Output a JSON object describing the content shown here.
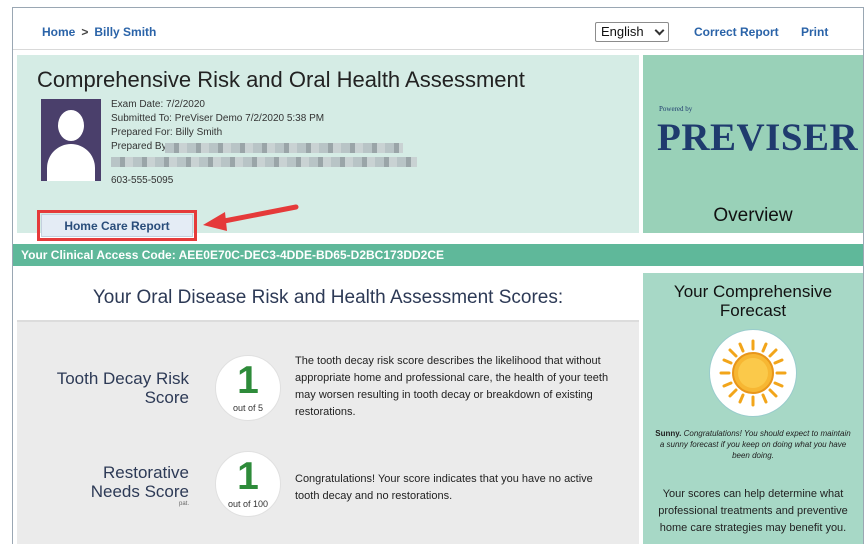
{
  "breadcrumb": {
    "home": "Home",
    "separator": ">",
    "current": "Billy Smith"
  },
  "language_select": {
    "value": "English"
  },
  "toplinks": {
    "correct_report": "Correct Report",
    "print": "Print"
  },
  "header": {
    "title": "Comprehensive Risk and Oral Health Assessment",
    "exam_date": "Exam Date: 7/2/2020",
    "submitted_to": "Submitted To: PreViser Demo 7/2/2020 5:38 PM",
    "prepared_for": "Prepared For: Billy Smith",
    "prepared_by": "Prepared By:",
    "phone": "603-555-5095",
    "home_care_button": "Home Care Report"
  },
  "brand": {
    "powered_by": "Powered by",
    "logo": "PREVISER",
    "panel_label": "Overview"
  },
  "access_code": {
    "text": "Your Clinical Access Code: AEE0E70C-DEC3-4DDE-BD65-D2BC173DD2CE"
  },
  "scores": {
    "title": "Your Oral Disease Risk and Health Assessment Scores:",
    "items": [
      {
        "name_line1": "Tooth Decay Risk",
        "name_line2": "Score",
        "value": "1",
        "out_of": "out of 5",
        "description": "The tooth decay risk score describes the likelihood that without appropriate home and professional care, the health of your teeth may worsen resulting in tooth decay or breakdown of existing restorations."
      },
      {
        "name_line1": "Restorative",
        "name_line2": "Needs Score",
        "suffix": "pat.",
        "value": "1",
        "out_of": "out of 100",
        "description": "Congratulations! Your score indicates that you have no active tooth decay and no restorations."
      }
    ]
  },
  "forecast": {
    "title_line1": "Your Comprehensive",
    "title_line2": "Forecast",
    "icon": "sun-icon",
    "sunny_label": "Sunny.",
    "sunny_text": "Congratulations! You should expect to maintain a sunny forecast if you keep on doing what you have been doing.",
    "summary": "Your scores can help determine what professional treatments and preventive home care strategies may benefit you."
  },
  "colors": {
    "header_bg": "#d5ece5",
    "brand_bg": "#99d1b8",
    "code_bar": "#5fb89a",
    "score_green": "#2e8b3a",
    "highlight_red": "#e53a3a",
    "link_blue": "#2a63a8"
  }
}
